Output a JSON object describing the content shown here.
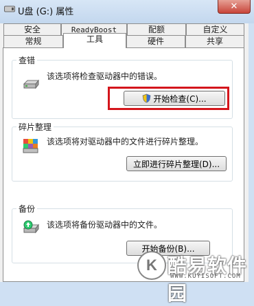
{
  "window": {
    "title": "U盘 (G:) 属性",
    "close_label": "✕"
  },
  "tabs_row1": [
    "安全",
    "ReadyBoost",
    "配额",
    "自定义"
  ],
  "tabs_row2": [
    "常规",
    "工具",
    "硬件",
    "共享"
  ],
  "active_tab": "工具",
  "sections": [
    {
      "title": "查错",
      "description": "该选项将检查驱动器中的错误。",
      "button": "开始检查(C)..."
    },
    {
      "title": "碎片整理",
      "description": "该选项将对驱动器中的文件进行碎片整理。",
      "button": "立即进行碎片整理(D)..."
    },
    {
      "title": "备份",
      "description": "该选项将备份驱动器中的文件。",
      "button": "开始备份(B)..."
    }
  ],
  "watermark": {
    "logo": "K",
    "text": "酷易软件园",
    "url": "WWW.KUYISOFT.COM"
  },
  "colors": {
    "highlight": "#d4151c",
    "title_bar": "#c3d7ee"
  }
}
